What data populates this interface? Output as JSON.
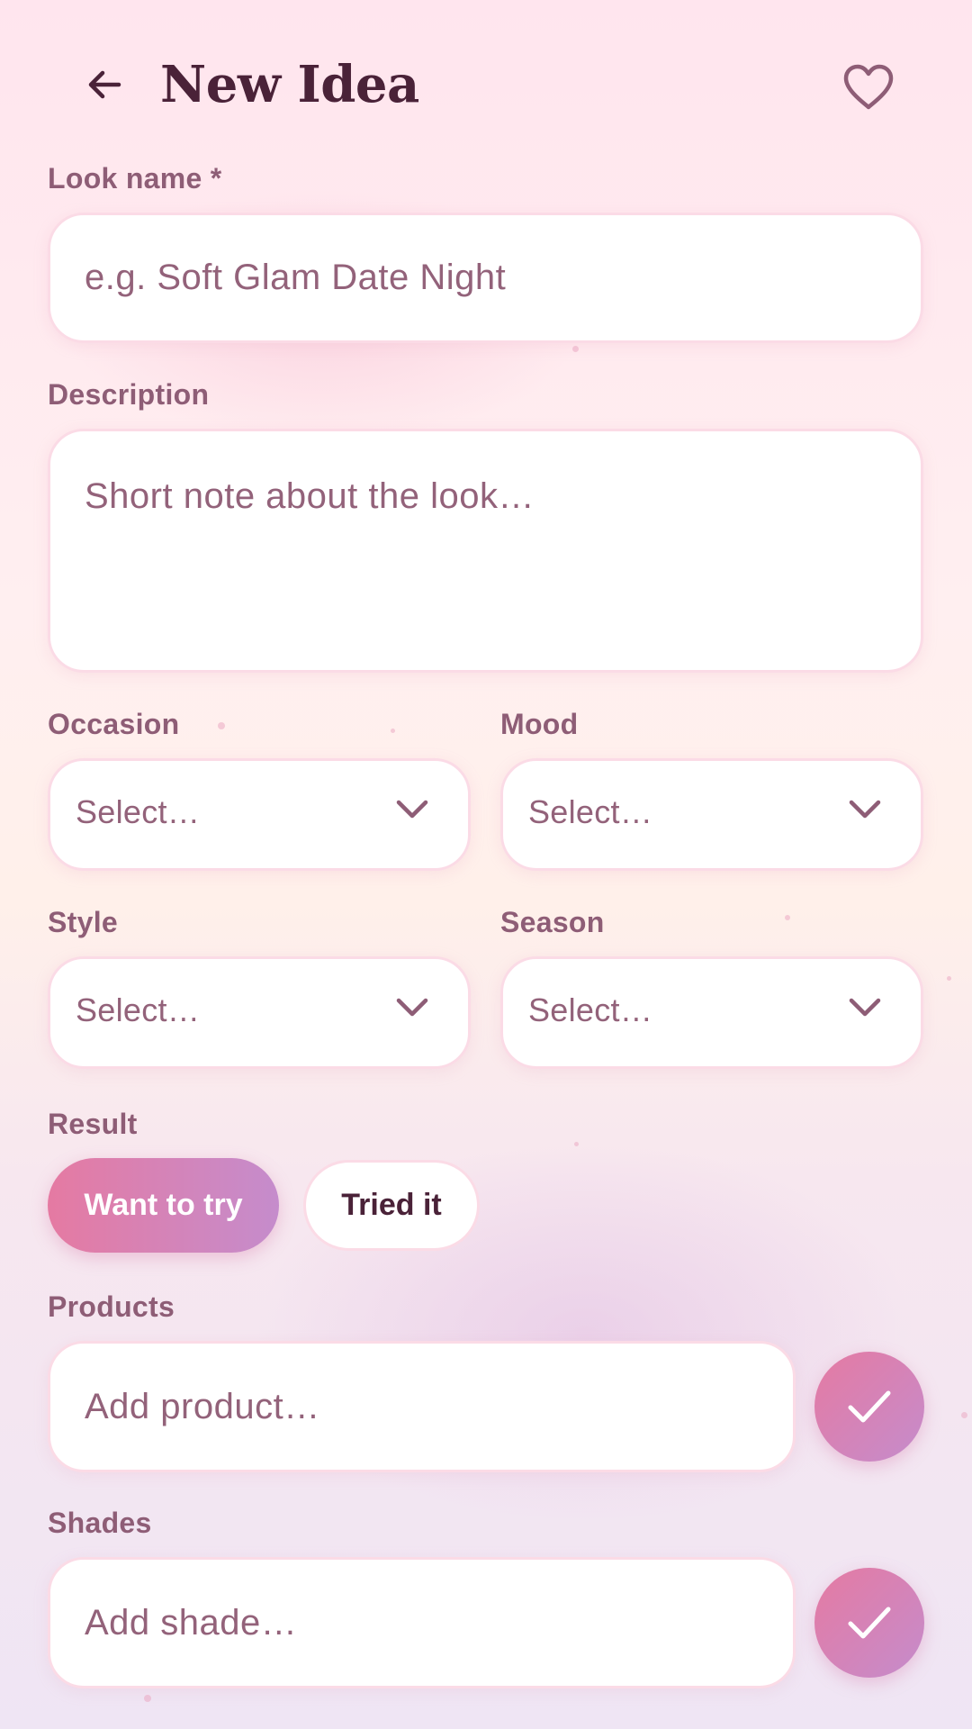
{
  "header": {
    "title": "New Idea",
    "back_icon": "arrow-left-icon",
    "favorite_icon": "heart-outline-icon"
  },
  "form": {
    "look_name": {
      "label": "Look name *",
      "placeholder": "e.g. Soft Glam Date Night",
      "value": ""
    },
    "description": {
      "label": "Description",
      "placeholder": "Short note about the look…",
      "value": ""
    },
    "occasion": {
      "label": "Occasion",
      "value": "Select…"
    },
    "mood": {
      "label": "Mood",
      "value": "Select…"
    },
    "style": {
      "label": "Style",
      "value": "Select…"
    },
    "season": {
      "label": "Season",
      "value": "Select…"
    },
    "result": {
      "label": "Result",
      "options": [
        {
          "label": "Want to try",
          "selected": true
        },
        {
          "label": "Tried it",
          "selected": false
        }
      ]
    },
    "products": {
      "label": "Products",
      "placeholder": "Add product…",
      "button_icon": "check-icon"
    },
    "shades": {
      "label": "Shades",
      "placeholder": "Add shade…",
      "button_icon": "check-icon"
    }
  },
  "colors": {
    "accent_start": "#e57aa2",
    "accent_end": "#c58ccc",
    "title_text": "#4a2238",
    "label_text": "#8e5d76",
    "placeholder_text": "#93627a",
    "field_border": "#fbdbe6"
  }
}
